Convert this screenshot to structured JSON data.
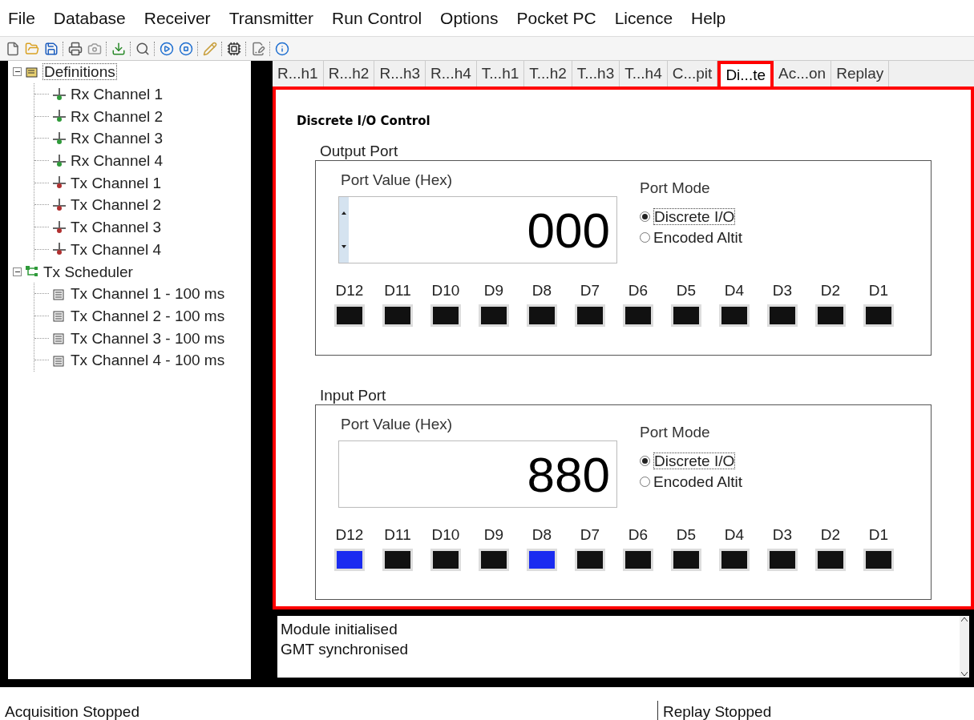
{
  "menu": [
    "File",
    "Database",
    "Receiver",
    "Transmitter",
    "Run Control",
    "Options",
    "Pocket PC",
    "Licence",
    "Help"
  ],
  "tree": [
    {
      "label": "Definitions",
      "kind": "folder",
      "expanded": true,
      "children": [
        {
          "label": "Rx Channel 1",
          "kind": "rx"
        },
        {
          "label": "Rx Channel 2",
          "kind": "rx"
        },
        {
          "label": "Rx Channel 3",
          "kind": "rx"
        },
        {
          "label": "Rx Channel 4",
          "kind": "rx"
        },
        {
          "label": "Tx Channel 1",
          "kind": "tx"
        },
        {
          "label": "Tx Channel 2",
          "kind": "tx"
        },
        {
          "label": "Tx Channel 3",
          "kind": "tx"
        },
        {
          "label": "Tx Channel 4",
          "kind": "tx"
        }
      ]
    },
    {
      "label": "Tx Scheduler",
      "kind": "scheduler",
      "expanded": true,
      "children": [
        {
          "label": "Tx Channel 1 - 100 ms",
          "kind": "schedule"
        },
        {
          "label": "Tx Channel 2 - 100 ms",
          "kind": "schedule"
        },
        {
          "label": "Tx Channel 3 - 100 ms",
          "kind": "schedule"
        },
        {
          "label": "Tx Channel 4 - 100 ms",
          "kind": "schedule"
        }
      ]
    }
  ],
  "tabs": [
    {
      "label": "R...h1",
      "selected": false
    },
    {
      "label": "R...h2",
      "selected": false
    },
    {
      "label": "R...h3",
      "selected": false
    },
    {
      "label": "R...h4",
      "selected": false
    },
    {
      "label": "T...h1",
      "selected": false
    },
    {
      "label": "T...h2",
      "selected": false
    },
    {
      "label": "T...h3",
      "selected": false
    },
    {
      "label": "T...h4",
      "selected": false
    },
    {
      "label": "C...pit",
      "selected": false
    },
    {
      "label": "Di...te",
      "selected": true
    },
    {
      "label": "Ac...on",
      "selected": false
    },
    {
      "label": "Replay",
      "selected": false
    }
  ],
  "panel_title": "Discrete I/O Control",
  "ports": [
    {
      "title": "Output Port",
      "value_label": "Port Value (Hex)",
      "value": "000",
      "spinner": true,
      "mode_label": "Port Mode",
      "modes": [
        {
          "label": "Discrete I/O",
          "selected": true
        },
        {
          "label": "Encoded Altit",
          "selected": false
        }
      ],
      "bits": [
        {
          "label": "D12",
          "on": false
        },
        {
          "label": "D11",
          "on": false
        },
        {
          "label": "D10",
          "on": false
        },
        {
          "label": "D9",
          "on": false
        },
        {
          "label": "D8",
          "on": false
        },
        {
          "label": "D7",
          "on": false
        },
        {
          "label": "D6",
          "on": false
        },
        {
          "label": "D5",
          "on": false
        },
        {
          "label": "D4",
          "on": false
        },
        {
          "label": "D3",
          "on": false
        },
        {
          "label": "D2",
          "on": false
        },
        {
          "label": "D1",
          "on": false
        }
      ]
    },
    {
      "title": "Input Port",
      "value_label": "Port Value (Hex)",
      "value": "880",
      "spinner": false,
      "mode_label": "Port Mode",
      "modes": [
        {
          "label": "Discrete I/O",
          "selected": true
        },
        {
          "label": "Encoded Altit",
          "selected": false
        }
      ],
      "bits": [
        {
          "label": "D12",
          "on": true
        },
        {
          "label": "D11",
          "on": false
        },
        {
          "label": "D10",
          "on": false
        },
        {
          "label": "D9",
          "on": false
        },
        {
          "label": "D8",
          "on": true
        },
        {
          "label": "D7",
          "on": false
        },
        {
          "label": "D6",
          "on": false
        },
        {
          "label": "D5",
          "on": false
        },
        {
          "label": "D4",
          "on": false
        },
        {
          "label": "D3",
          "on": false
        },
        {
          "label": "D2",
          "on": false
        },
        {
          "label": "D1",
          "on": false
        }
      ]
    }
  ],
  "log": [
    "Module initialised",
    "GMT synchronised"
  ],
  "status_bar": [
    "Acquisition Stopped",
    "Replay Stopped"
  ]
}
